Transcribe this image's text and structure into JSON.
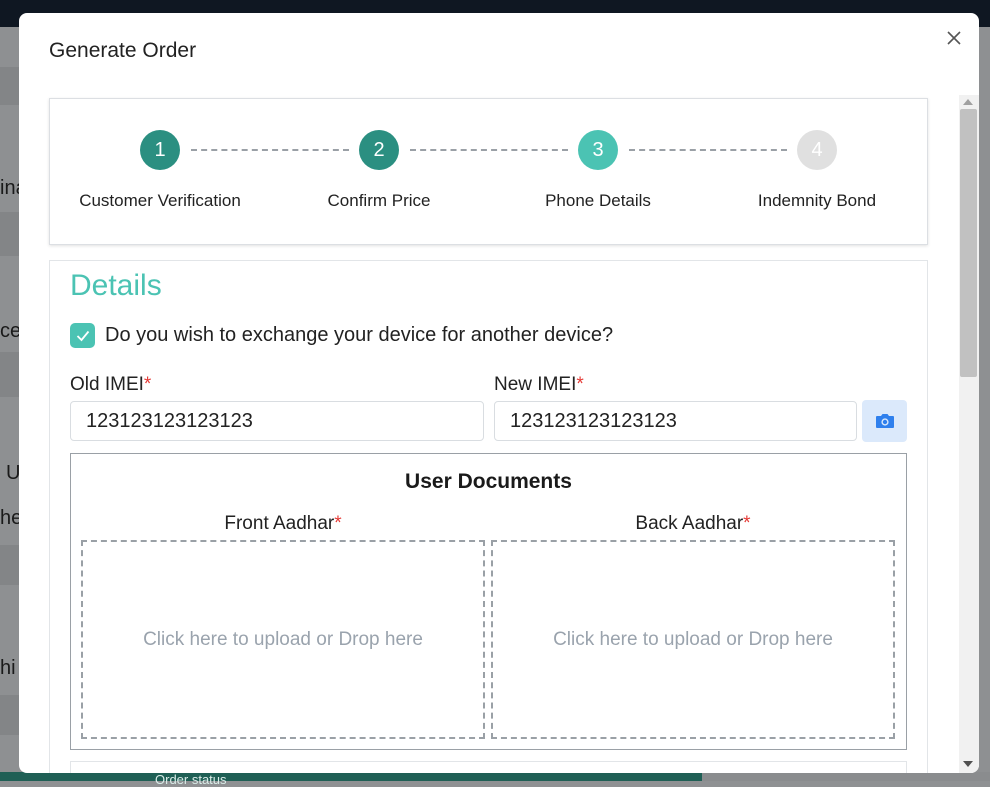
{
  "background": {
    "fragments": [
      "ina",
      "ce",
      "U",
      "hel",
      "hi"
    ],
    "bottom_text": "Order status"
  },
  "modal": {
    "title": "Generate Order",
    "close_glyph": "×"
  },
  "stepper": {
    "steps": [
      {
        "number": "1",
        "label": "Customer Verification",
        "state": "completed",
        "color": "#2b8f81"
      },
      {
        "number": "2",
        "label": "Confirm Price",
        "state": "completed",
        "color": "#2b8f81"
      },
      {
        "number": "3",
        "label": "Phone Details",
        "state": "active",
        "color": "#4bc3b3"
      },
      {
        "number": "4",
        "label": "Indemnity Bond",
        "state": "pending",
        "color": "#e0e0e0"
      }
    ]
  },
  "details": {
    "title": "Details",
    "exchange_checkbox": {
      "label": "Do you wish to exchange your device for another device?",
      "checked": true
    },
    "old_imei": {
      "label": "Old IMEI",
      "required_mark": "*",
      "value": "123123123123123"
    },
    "new_imei": {
      "label": "New IMEI",
      "required_mark": "*",
      "value": "123123123123123"
    },
    "camera_icon": "camera-icon"
  },
  "documents": {
    "title": "User Documents",
    "front": {
      "label": "Front Aadhar",
      "required_mark": "*",
      "dropzone_text": "Click here to upload or Drop here"
    },
    "back": {
      "label": "Back Aadhar",
      "required_mark": "*",
      "dropzone_text": "Click here to upload or Drop here"
    }
  },
  "colors": {
    "accent": "#4bc3b3",
    "completed": "#2b8f81",
    "pending": "#e0e0e0",
    "required": "#e53935"
  }
}
